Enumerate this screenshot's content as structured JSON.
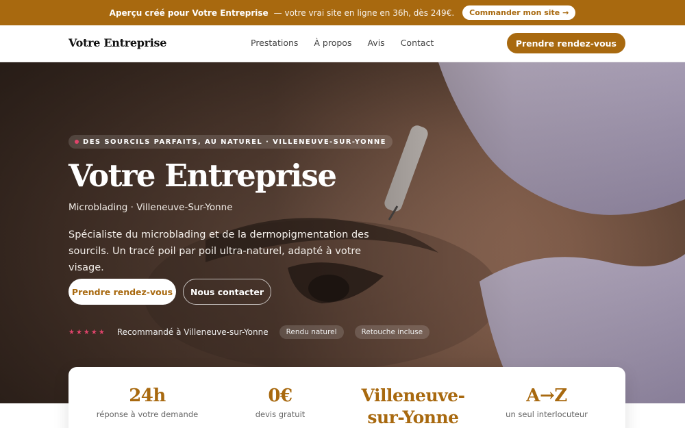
{
  "topbar": {
    "strong": "Aperçu créé pour Votre Entreprise",
    "rest": "— votre vrai site en ligne en 36h, dès 249€.",
    "cta": "Commander mon site →"
  },
  "nav": {
    "logo": "Votre Entreprise",
    "items": [
      "Prestations",
      "À propos",
      "Avis",
      "Contact"
    ],
    "cta": "Prendre rendez-vous"
  },
  "hero": {
    "eyebrow": "DES SOURCILS PARFAITS, AU NATUREL · VILLENEUVE-SUR-YONNE",
    "title": "Votre Entreprise",
    "subtitle": "Microblading · Villeneuve-Sur-Yonne",
    "description": "Spécialiste du microblading et de la dermopigmentation des sourcils. Un tracé poil par poil ultra-naturel, adapté à votre visage.",
    "primary_cta": "Prendre rendez-vous",
    "secondary_cta": "Nous contacter",
    "stars": "★★★★★",
    "trust_text": "Recommandé à Villeneuve-sur-Yonne",
    "pills": [
      "Rendu naturel",
      "Retouche incluse"
    ]
  },
  "stats": [
    {
      "value": "24h",
      "label": "réponse à votre demande"
    },
    {
      "value": "0€",
      "label": "devis gratuit"
    },
    {
      "value": "Villeneuve-sur-Yonne",
      "label": ""
    },
    {
      "value": "A→Z",
      "label": "un seul interlocuteur"
    }
  ],
  "colors": {
    "brand": "#a8690f",
    "accent_pink": "#e0446b"
  }
}
